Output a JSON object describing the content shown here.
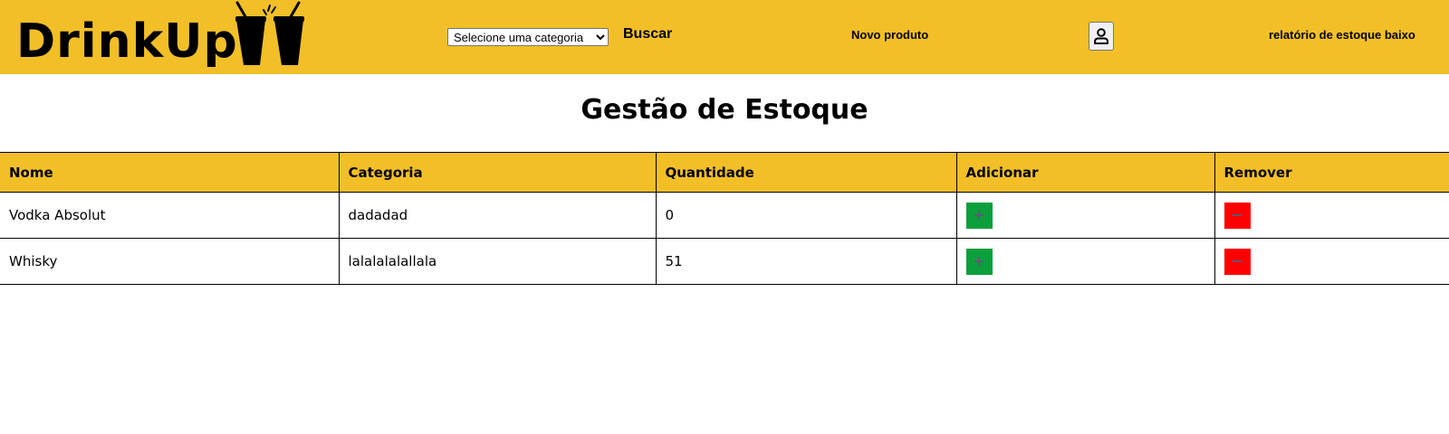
{
  "brand": {
    "name": "DrinkUp",
    "color": "#f2bf28"
  },
  "header": {
    "category_select": {
      "selected": "Selecione uma categoria"
    },
    "search_label": "Buscar",
    "new_product_label": "Novo produto",
    "user_icon": "user-icon",
    "report_label": "relatório de estoque baixo"
  },
  "main": {
    "title": "Gestão de Estoque",
    "columns": [
      "Nome",
      "Categoria",
      "Quantidade",
      "Adicionar",
      "Remover"
    ],
    "rows": [
      {
        "name": "Vodka Absolut",
        "category": "dadadad",
        "quantity": "0",
        "add": "+",
        "remove": "−"
      },
      {
        "name": "Whisky",
        "category": "lalalalalallala",
        "quantity": "51",
        "add": "+",
        "remove": "−"
      }
    ],
    "add_color": "#0ba03c",
    "remove_color": "#ff0000"
  }
}
